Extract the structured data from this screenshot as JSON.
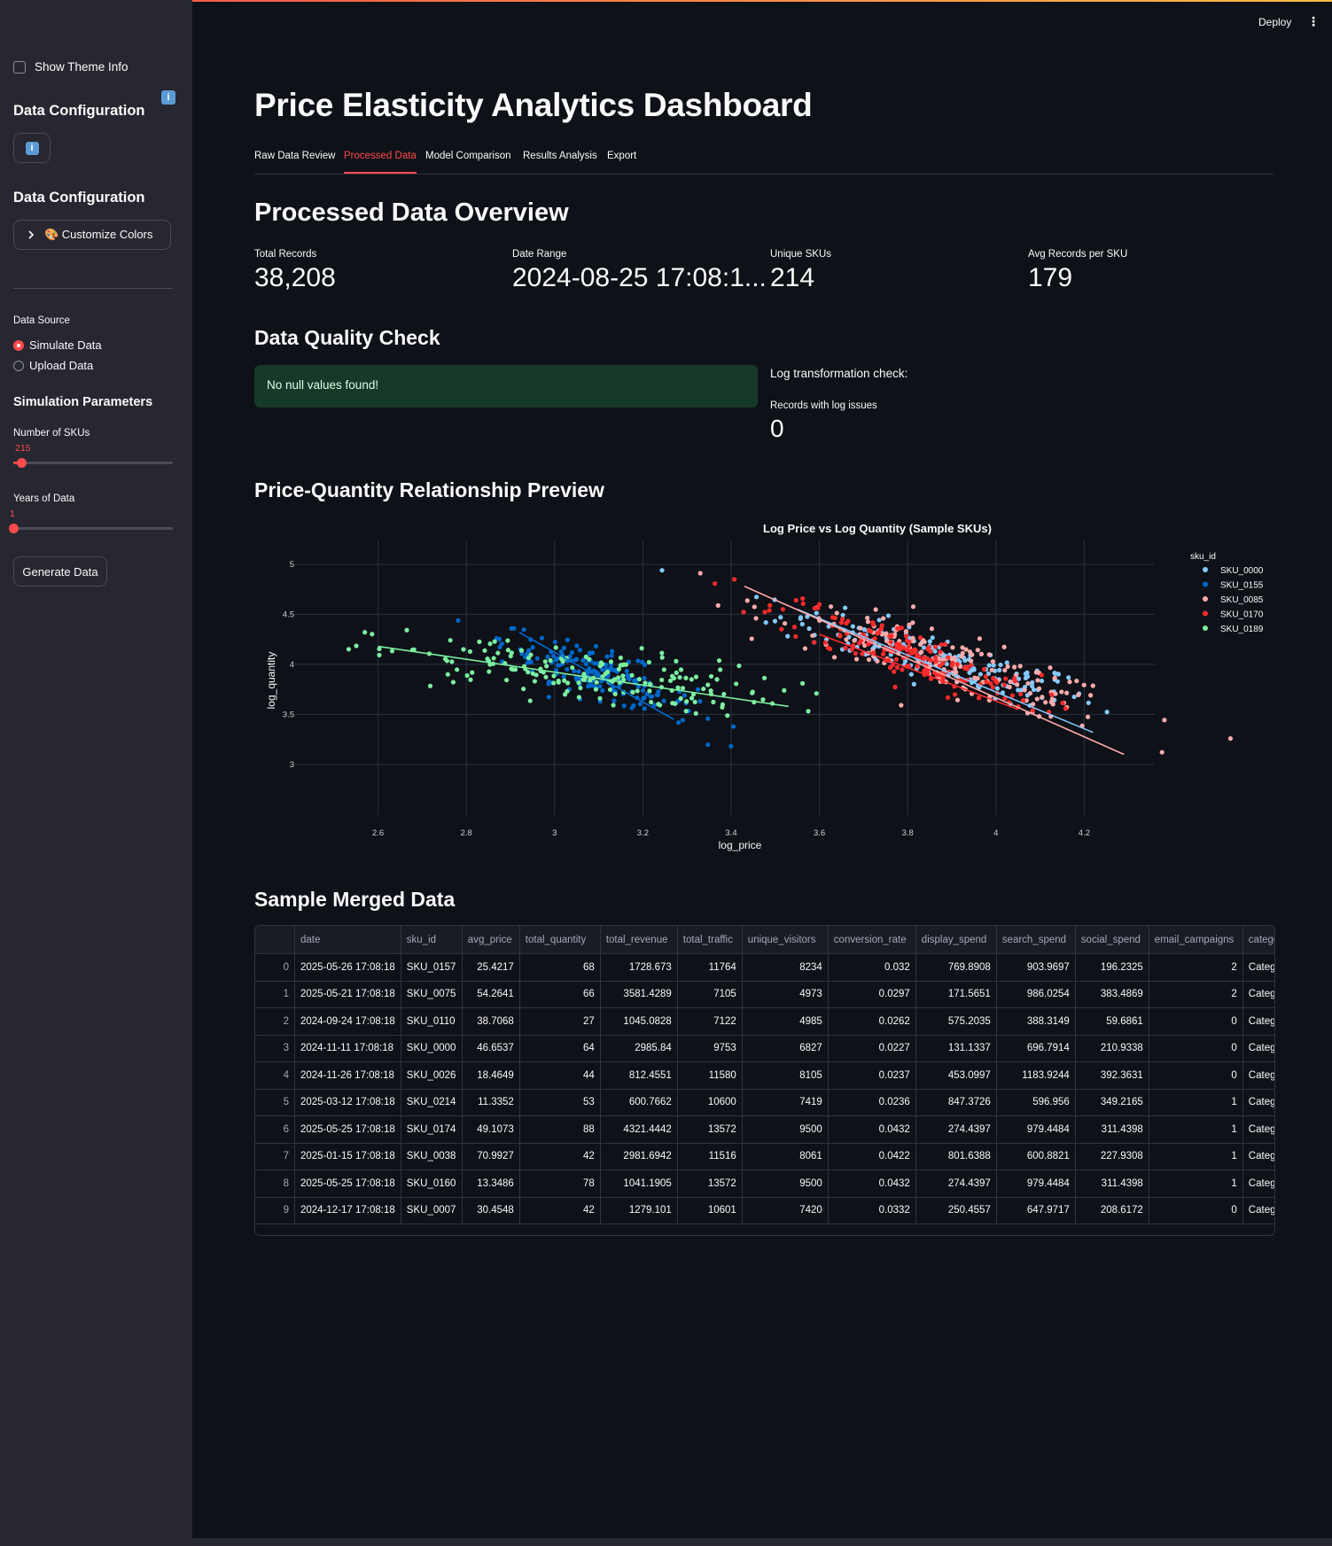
{
  "sidebar": {
    "show_theme_label": "Show Theme Info",
    "heading1": "Data Configuration",
    "heading2": "Data Configuration",
    "info_glyph": "i",
    "customize_label": "🎨 Customize Colors",
    "data_source_label": "Data Source",
    "radio_simulate": "Simulate Data",
    "radio_upload": "Upload Data",
    "radio_selected": "Simulate Data",
    "sim_params_heading": "Simulation Parameters",
    "num_skus_label": "Number of SKUs",
    "num_skus_value": "215",
    "num_skus_fraction": 0.05,
    "years_label": "Years of Data",
    "years_value": "1",
    "years_fraction": 0.0,
    "generate_label": "Generate Data"
  },
  "header": {
    "deploy_label": "Deploy",
    "menu_glyph": "⋮"
  },
  "main": {
    "title": "Price Elasticity Analytics Dashboard",
    "tabs": [
      {
        "label": "Raw Data Review",
        "active": false
      },
      {
        "label": "Processed Data",
        "active": true
      },
      {
        "label": "Model Comparison",
        "active": false
      },
      {
        "label": "Results Analysis",
        "active": false
      },
      {
        "label": "Export",
        "active": false
      }
    ],
    "overview_heading": "Processed Data Overview",
    "metrics": [
      {
        "label": "Total Records",
        "value": "38,208"
      },
      {
        "label": "Date Range",
        "value": "2024-08-25 17:08:1..."
      },
      {
        "label": "Unique SKUs",
        "value": "214"
      },
      {
        "label": "Avg Records per SKU",
        "value": "179"
      }
    ],
    "quality_heading": "Data Quality Check",
    "success_msg": "No null values found!",
    "log_check_label": "Log transformation check:",
    "log_issue_label": "Records with log issues",
    "log_issue_value": "0",
    "preview_heading": "Price-Quantity Relationship Preview",
    "sample_heading": "Sample Merged Data"
  },
  "chart_data": {
    "type": "scatter",
    "title": "Log Price vs Log Quantity (Sample SKUs)",
    "xlabel": "log_price",
    "ylabel": "log_quantity",
    "xlim": [
      2.4,
      4.4
    ],
    "ylim": [
      2.6,
      5.15
    ],
    "xticks": [
      2.6,
      2.8,
      3,
      3.2,
      3.4,
      3.6,
      3.8,
      4,
      4.2
    ],
    "yticks": [
      3,
      3.5,
      4,
      4.5,
      5
    ],
    "legend_title": "sku_id",
    "legend_position": "top-right",
    "grid": true,
    "series": [
      {
        "name": "SKU_0000",
        "color": "#83c9ff",
        "cx": 3.87,
        "cy": 4.05,
        "sx": 0.18,
        "sy": 0.12,
        "slope": -1.2,
        "n": 180,
        "trend": [
          [
            3.55,
            4.55
          ],
          [
            4.22,
            3.32
          ]
        ]
      },
      {
        "name": "SKU_0155",
        "color": "#0068c9",
        "cx": 3.1,
        "cy": 3.9,
        "sx": 0.11,
        "sy": 0.12,
        "slope": -1.6,
        "n": 180,
        "trend": [
          [
            2.92,
            4.32
          ],
          [
            3.27,
            3.45
          ]
        ]
      },
      {
        "name": "SKU_0085",
        "color": "#ffabab",
        "cx": 3.9,
        "cy": 4.0,
        "sx": 0.2,
        "sy": 0.14,
        "slope": -1.35,
        "n": 180,
        "trend": [
          [
            3.43,
            4.78
          ],
          [
            4.29,
            3.1
          ]
        ]
      },
      {
        "name": "SKU_0170",
        "color": "#ff2b2b",
        "cx": 3.8,
        "cy": 4.1,
        "sx": 0.15,
        "sy": 0.13,
        "slope": -1.55,
        "n": 180,
        "trend": [
          [
            3.6,
            4.3
          ],
          [
            4.05,
            3.55
          ]
        ]
      },
      {
        "name": "SKU_0189",
        "color": "#7defa1",
        "cx": 3.05,
        "cy": 3.9,
        "sx": 0.23,
        "sy": 0.14,
        "slope": -0.45,
        "n": 180,
        "trend": [
          [
            2.6,
            4.18
          ],
          [
            3.53,
            3.58
          ]
        ]
      }
    ]
  },
  "table": {
    "columns": [
      "",
      "date",
      "sku_id",
      "avg_price",
      "total_quantity",
      "total_revenue",
      "total_traffic",
      "unique_visitors",
      "conversion_rate",
      "display_spend",
      "search_spend",
      "social_spend",
      "email_campaigns",
      "category"
    ],
    "rows": [
      [
        "0",
        "2025-05-26 17:08:18",
        "SKU_0157",
        "25.4217",
        "68",
        "1728.673",
        "11764",
        "8234",
        "0.032",
        "769.8908",
        "903.9697",
        "196.2325",
        "2",
        "Category_"
      ],
      [
        "1",
        "2025-05-21 17:08:18",
        "SKU_0075",
        "54.2641",
        "66",
        "3581.4289",
        "7105",
        "4973",
        "0.0297",
        "171.5651",
        "986.0254",
        "383.4869",
        "2",
        "Category_"
      ],
      [
        "2",
        "2024-09-24 17:08:18",
        "SKU_0110",
        "38.7068",
        "27",
        "1045.0828",
        "7122",
        "4985",
        "0.0262",
        "575.2035",
        "388.3149",
        "59.6861",
        "0",
        "Category_"
      ],
      [
        "3",
        "2024-11-11 17:08:18",
        "SKU_0000",
        "46.6537",
        "64",
        "2985.84",
        "9753",
        "6827",
        "0.0227",
        "131.1337",
        "696.7914",
        "210.9338",
        "0",
        "Category_"
      ],
      [
        "4",
        "2024-11-26 17:08:18",
        "SKU_0026",
        "18.4649",
        "44",
        "812.4551",
        "11580",
        "8105",
        "0.0237",
        "453.0997",
        "1183.9244",
        "392.3631",
        "0",
        "Category_"
      ],
      [
        "5",
        "2025-03-12 17:08:18",
        "SKU_0214",
        "11.3352",
        "53",
        "600.7662",
        "10600",
        "7419",
        "0.0236",
        "847.3726",
        "596.956",
        "349.2165",
        "1",
        "Category_"
      ],
      [
        "6",
        "2025-05-25 17:08:18",
        "SKU_0174",
        "49.1073",
        "88",
        "4321.4442",
        "13572",
        "9500",
        "0.0432",
        "274.4397",
        "979.4484",
        "311.4398",
        "1",
        "Category_"
      ],
      [
        "7",
        "2025-01-15 17:08:18",
        "SKU_0038",
        "70.9927",
        "42",
        "2981.6942",
        "11516",
        "8061",
        "0.0422",
        "801.6388",
        "600.8821",
        "227.9308",
        "1",
        "Category_"
      ],
      [
        "8",
        "2025-05-25 17:08:18",
        "SKU_0160",
        "13.3486",
        "78",
        "1041.1905",
        "13572",
        "9500",
        "0.0432",
        "274.4397",
        "979.4484",
        "311.4398",
        "1",
        "Category_"
      ],
      [
        "9",
        "2024-12-17 17:08:18",
        "SKU_0007",
        "30.4548",
        "42",
        "1279.101",
        "10601",
        "7420",
        "0.0332",
        "250.4557",
        "647.9717",
        "208.6172",
        "0",
        "Category_"
      ]
    ]
  },
  "colors": {
    "accent": "#ff4b4b",
    "background": "#0e1117",
    "sidebar": "#262730",
    "success_bg": "#173928"
  }
}
